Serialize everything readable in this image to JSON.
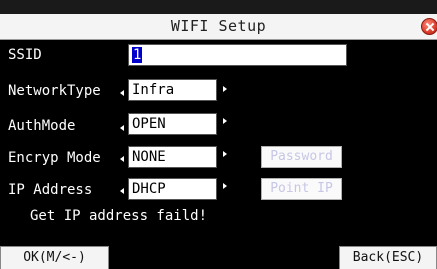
{
  "window": {
    "title": "WIFI Setup"
  },
  "fields": {
    "ssid": {
      "label": "SSID",
      "value": "1"
    },
    "network_type": {
      "label": "NetworkType",
      "value": "Infra"
    },
    "auth_mode": {
      "label": "AuthMode",
      "value": "OPEN"
    },
    "encryp_mode": {
      "label": "Encryp Mode",
      "value": "NONE"
    },
    "ip_address": {
      "label": "IP Address",
      "value": "DHCP"
    }
  },
  "buttons": {
    "password": "Password",
    "point_ip": "Point IP",
    "ok": "OK(M/<-)",
    "back": "Back(ESC)"
  },
  "status": "Get IP address faild!"
}
